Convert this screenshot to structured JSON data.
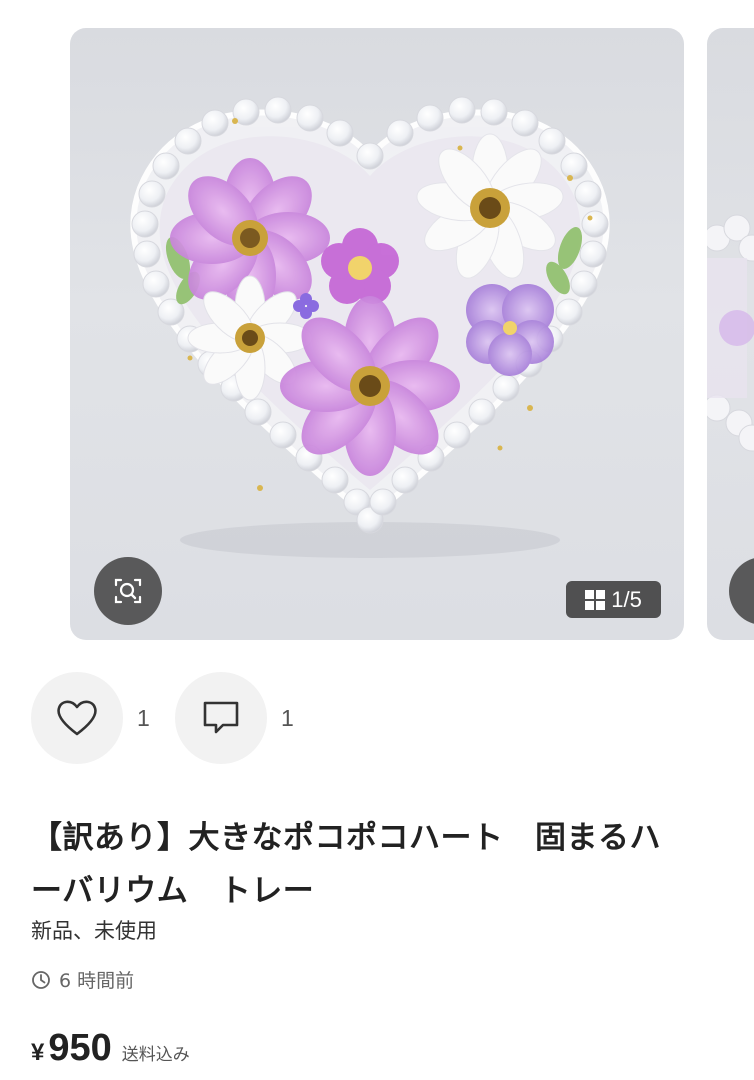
{
  "carousel": {
    "counter_current": "1",
    "counter_separator": "/",
    "counter_total": "5",
    "zoom_icon": "zoom-search-icon",
    "counter_icon": "grid-icon"
  },
  "actions": {
    "like_icon": "heart-icon",
    "like_count": "1",
    "comment_icon": "comment-icon",
    "comment_count": "1"
  },
  "item": {
    "title_line1": "【訳あり】大きなポコポコハート　固まるハ",
    "title_line2": "ーバリウム　トレー",
    "condition": "新品、未使用",
    "posted": "6 時間前",
    "currency": "¥",
    "price": "950",
    "shipping": "送料込み"
  },
  "colors": {
    "accent_purple": "#b57be0",
    "button_bg": "#f2f2f2",
    "overlay_dark": "#3c3c3c"
  }
}
